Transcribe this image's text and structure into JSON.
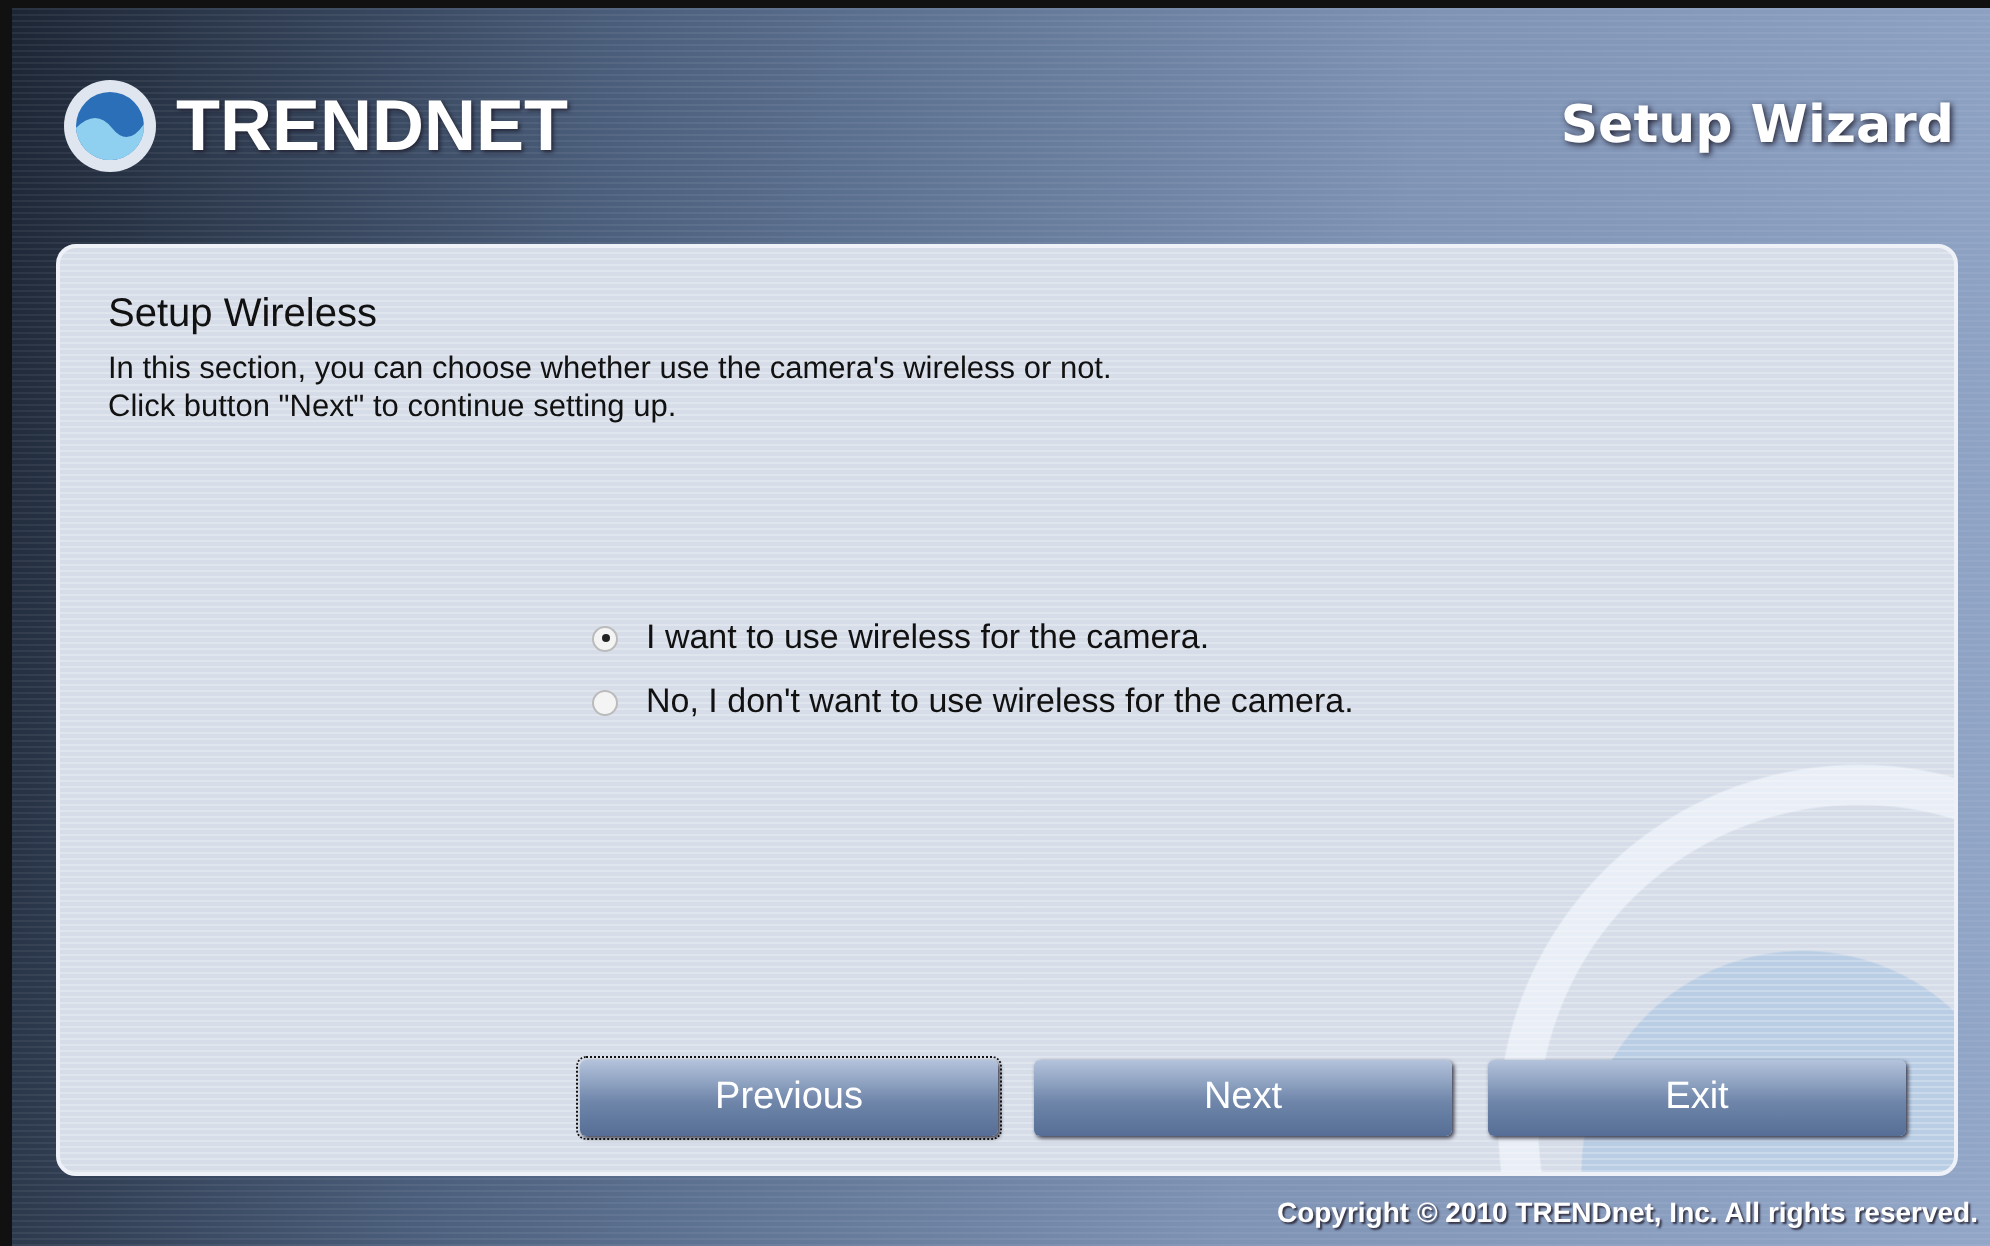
{
  "header": {
    "brand": "TRENDNET",
    "title": "Setup Wizard"
  },
  "panel": {
    "heading": "Setup Wireless",
    "description": [
      "In this section, you can choose whether use the camera's wireless or not.",
      "Click button \"Next\" to continue setting up."
    ],
    "options": [
      {
        "label": "I want to use wireless for the camera.",
        "selected": true
      },
      {
        "label": "No, I don't want to use wireless for the camera.",
        "selected": false
      }
    ],
    "buttons": [
      {
        "label": "Previous",
        "focused": true
      },
      {
        "label": "Next",
        "focused": false
      },
      {
        "label": "Exit",
        "focused": false
      }
    ]
  },
  "footer": {
    "copyright": "Copyright © 2010 TRENDnet, Inc. All rights reserved."
  }
}
